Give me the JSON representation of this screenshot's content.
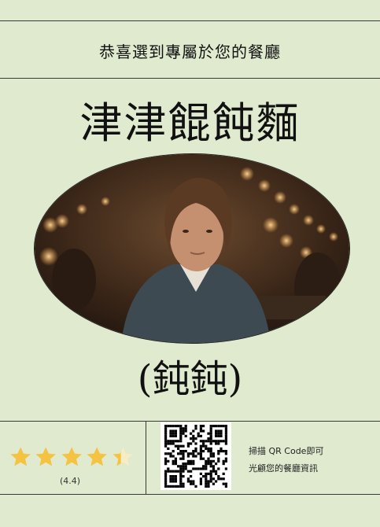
{
  "header": {
    "title": "恭喜選到專屬於您的餐廳"
  },
  "restaurant": {
    "name": "津津餛飩麵",
    "nickname": "(鈍鈍)"
  },
  "rating": {
    "stars": 4.4,
    "max": 5,
    "label": "(4.4)",
    "star_color": "#f5c242"
  },
  "qr_info": {
    "line1": "掃描 QR Code即可",
    "line2": "光顧您的餐廳資訊"
  }
}
